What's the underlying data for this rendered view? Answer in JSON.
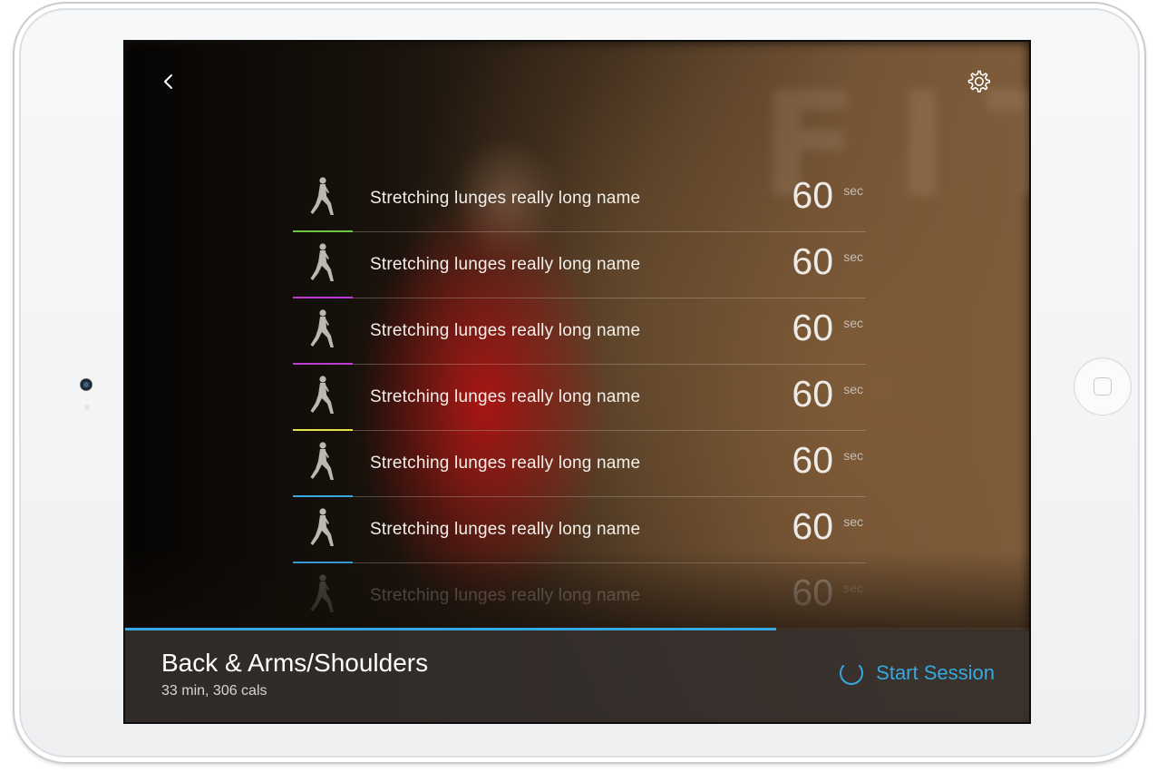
{
  "session": {
    "title": "Back & Arms/Shoulders",
    "meta": "33 min, 306 cals",
    "start_label": "Start Session",
    "progress": 0.72
  },
  "colors": {
    "accent_blue": "#36a9e1",
    "green": "#6cc644",
    "purple": "#c03bd6",
    "yellow": "#e6e04a",
    "blue": "#36a9e1"
  },
  "icons": {
    "back": "chevron-left-icon",
    "settings": "gear-icon",
    "exercise": "lunge-figure-icon"
  },
  "exercises": [
    {
      "name": "Stretching lunges really long name",
      "duration": "60",
      "unit": "sec",
      "accent": "#6cc644"
    },
    {
      "name": "Stretching lunges really long name",
      "duration": "60",
      "unit": "sec",
      "accent": "#c03bd6"
    },
    {
      "name": "Stretching lunges really long name",
      "duration": "60",
      "unit": "sec",
      "accent": "#c03bd6"
    },
    {
      "name": "Stretching lunges really long name",
      "duration": "60",
      "unit": "sec",
      "accent": "#e6e04a"
    },
    {
      "name": "Stretching lunges really long name",
      "duration": "60",
      "unit": "sec",
      "accent": "#36a9e1"
    },
    {
      "name": "Stretching lunges really long name",
      "duration": "60",
      "unit": "sec",
      "accent": "#36a9e1"
    },
    {
      "name": "Stretching lunges really long name",
      "duration": "60",
      "unit": "sec",
      "accent": "#36a9e1"
    }
  ]
}
